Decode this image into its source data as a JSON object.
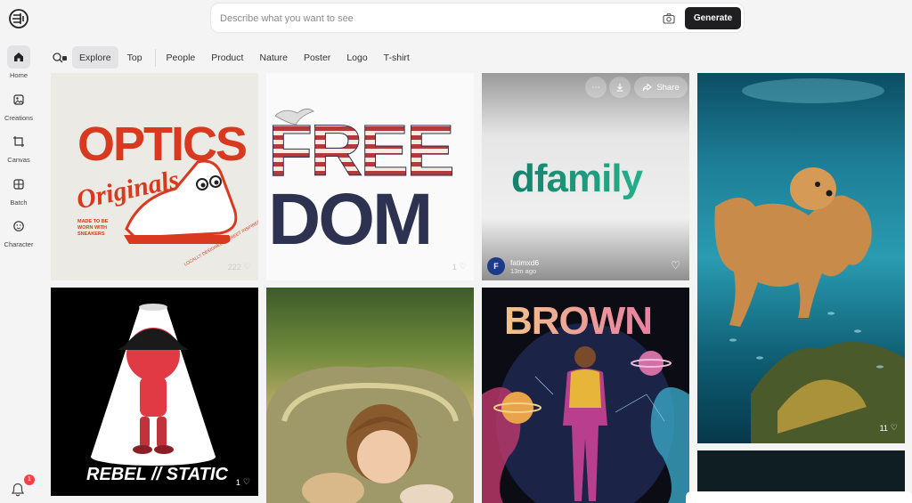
{
  "sidebar": {
    "logo": "brain-logo-icon",
    "items": [
      {
        "label": "Home",
        "icon": "home-icon",
        "active": true
      },
      {
        "label": "Creations",
        "icon": "image-icon"
      },
      {
        "label": "Canvas",
        "icon": "crop-icon"
      },
      {
        "label": "Batch",
        "icon": "grid-icon"
      },
      {
        "label": "Character",
        "icon": "face-icon"
      }
    ],
    "notifications": {
      "icon": "bell-icon",
      "count": "1"
    }
  },
  "search": {
    "placeholder": "Describe what you want to see",
    "value": "",
    "camera_icon": "camera-icon",
    "generate_label": "Generate"
  },
  "filters": {
    "search_icon": "search-lock-icon",
    "tabs": [
      "Explore",
      "Top",
      "People",
      "Product",
      "Nature",
      "Poster",
      "Logo",
      "T-shirt"
    ],
    "active": "Explore"
  },
  "gallery": {
    "optics": {
      "line1": "OPTICS",
      "line2": "Originals",
      "tag1": "MADE TO BE",
      "tag2": "WORN WITH",
      "tag3": "SNEAKERS",
      "tag4": "LOCALLY DESIGNED | STREET INSPIRED",
      "likes": "222"
    },
    "freedom": {
      "line1": "FREE",
      "line2": "DOM",
      "likes": "1"
    },
    "dfamily": {
      "brand": "dfamily",
      "share_label": "Share",
      "author": "fatimxd6",
      "author_initial": "F",
      "time": "13m ago"
    },
    "dog": {
      "likes": "11"
    },
    "rebel": {
      "text": "REBEL // STATIC",
      "likes": "1"
    },
    "brown": {
      "title": "BROWN"
    }
  },
  "colors": {
    "accent": "#1f1f22",
    "badge": "#ef4444",
    "optics_red": "#d9391f",
    "dfamily_green": "#17806b"
  }
}
